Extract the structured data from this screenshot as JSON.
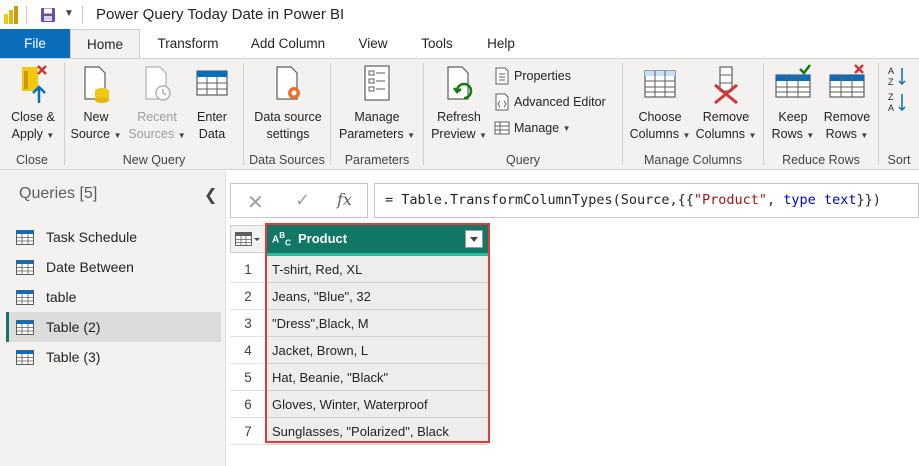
{
  "window": {
    "title": "Power Query Today Date in Power BI"
  },
  "tabs": [
    "File",
    "Home",
    "Transform",
    "Add Column",
    "View",
    "Tools",
    "Help"
  ],
  "ribbon": {
    "close": {
      "btn1": "Close &",
      "btn1b": "Apply",
      "label": "Close"
    },
    "new_query": {
      "new": "New",
      "new_b": "Source",
      "recent": "Recent",
      "recent_b": "Sources",
      "enter": "Enter",
      "enter_b": "Data",
      "label": "New Query"
    },
    "data_sources": {
      "btn": "Data source",
      "btn_b": "settings",
      "label": "Data Sources"
    },
    "parameters": {
      "btn": "Manage",
      "btn_b": "Parameters",
      "label": "Parameters"
    },
    "query": {
      "refresh": "Refresh",
      "refresh_b": "Preview",
      "properties": "Properties",
      "advanced": "Advanced Editor",
      "manage": "Manage",
      "label": "Query"
    },
    "manage_columns": {
      "choose": "Choose",
      "choose_b": "Columns",
      "remove": "Remove",
      "remove_b": "Columns",
      "label": "Manage Columns"
    },
    "reduce_rows": {
      "keep": "Keep",
      "keep_b": "Rows",
      "remove": "Remove",
      "remove_b": "Rows",
      "label": "Reduce Rows"
    },
    "sort": {
      "label": "Sort"
    }
  },
  "queries": {
    "title": "Queries [5]",
    "items": [
      "Task Schedule",
      "Date Between",
      "table",
      "Table (2)",
      "Table (3)"
    ],
    "selected_index": 3
  },
  "formula": {
    "prefix": "= Table.TransformColumnTypes(Source,{{",
    "str": "\"Product\"",
    "mid": ", ",
    "kw": "type",
    "sp": " ",
    "kw2": "text",
    "suffix": "}})"
  },
  "grid": {
    "column": "Product",
    "type_icon": "ABC",
    "rows": [
      "T-shirt, Red, XL",
      "Jeans, \"Blue\", 32",
      "\"Dress\",Black, M",
      "Jacket, Brown, L",
      "Hat, Beanie, \"Black\"",
      "Gloves, Winter, Waterproof",
      "Sunglasses, \"Polarized\", Black"
    ],
    "row_numbers": [
      "1",
      "2",
      "3",
      "4",
      "5",
      "6",
      "7"
    ]
  },
  "colors": {
    "accent": "#117865",
    "file_tab": "#0a6ebd",
    "highlight": "#e03b3b"
  }
}
